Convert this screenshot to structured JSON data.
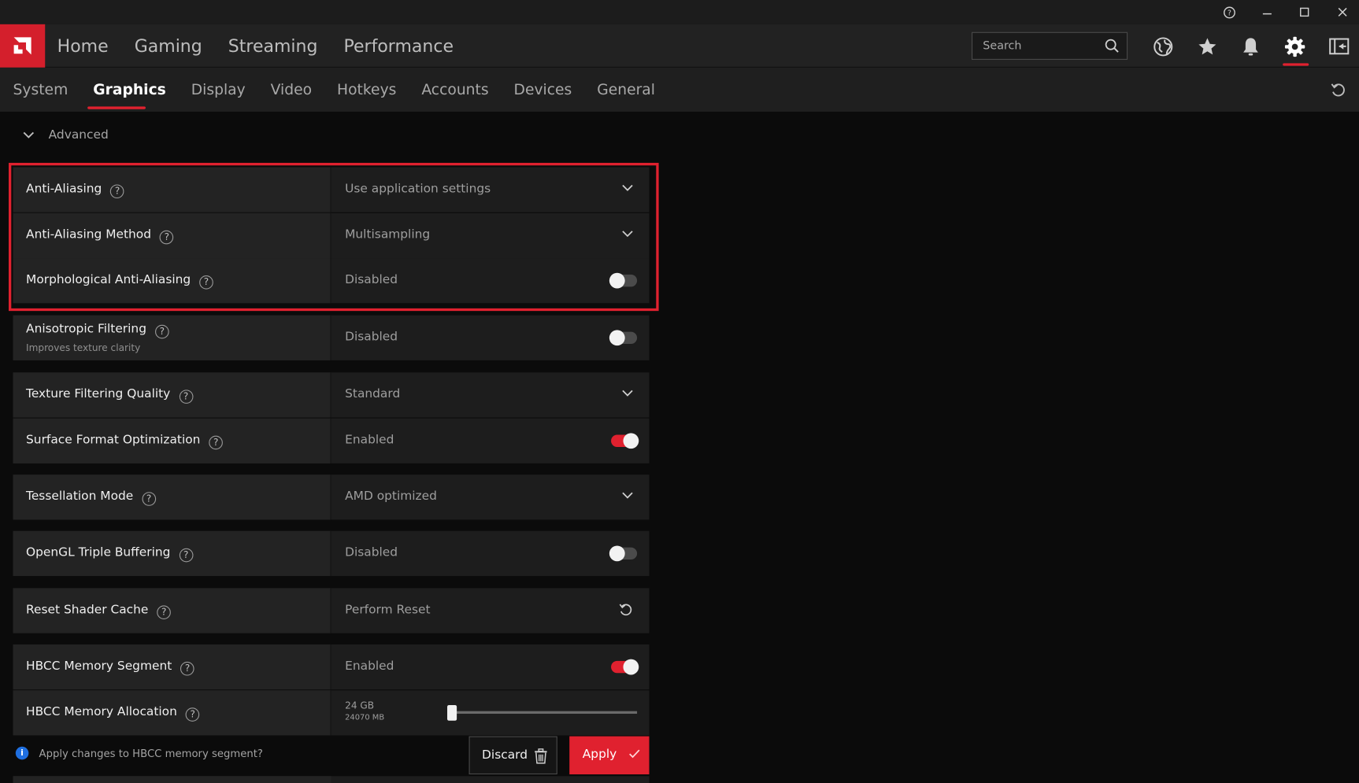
{
  "window": {
    "help": "?",
    "minimize": "–",
    "maximize": "□",
    "close": "✕"
  },
  "header": {
    "nav": [
      "Home",
      "Gaming",
      "Streaming",
      "Performance"
    ],
    "search_placeholder": "Search"
  },
  "subnav": {
    "tabs": [
      "System",
      "Graphics",
      "Display",
      "Video",
      "Hotkeys",
      "Accounts",
      "Devices",
      "General"
    ],
    "active": "Graphics"
  },
  "section": {
    "title": "Advanced"
  },
  "settings": [
    {
      "label": "Anti-Aliasing",
      "value": "Use application settings",
      "control": "dropdown"
    },
    {
      "label": "Anti-Aliasing Method",
      "value": "Multisampling",
      "control": "dropdown"
    },
    {
      "label": "Morphological Anti-Aliasing",
      "value": "Disabled",
      "control": "toggle",
      "on": false
    },
    {
      "label": "Anisotropic Filtering",
      "sublabel": "Improves texture clarity",
      "value": "Disabled",
      "control": "toggle",
      "on": false
    },
    {
      "label": "Texture Filtering Quality",
      "value": "Standard",
      "control": "dropdown"
    },
    {
      "label": "Surface Format Optimization",
      "value": "Enabled",
      "control": "toggle",
      "on": true
    },
    {
      "label": "Tessellation Mode",
      "value": "AMD optimized",
      "control": "dropdown"
    },
    {
      "label": "OpenGL Triple Buffering",
      "value": "Disabled",
      "control": "toggle",
      "on": false
    },
    {
      "label": "Reset Shader Cache",
      "value": "Perform Reset",
      "control": "reset"
    },
    {
      "label": "HBCC Memory Segment",
      "value": "Enabled",
      "control": "toggle",
      "on": true
    },
    {
      "label": "HBCC Memory Allocation",
      "value": "24 GB",
      "value2": "24070 MB",
      "control": "slider",
      "slider_fraction": 0.0
    }
  ],
  "footer": {
    "message": "Apply changes to HBCC memory segment?",
    "discard": "Discard",
    "apply": "Apply"
  },
  "colors": {
    "accent": "#e0212f",
    "background": "#0b0b0b",
    "panel": "#232323",
    "info": "#1f6fe0"
  }
}
